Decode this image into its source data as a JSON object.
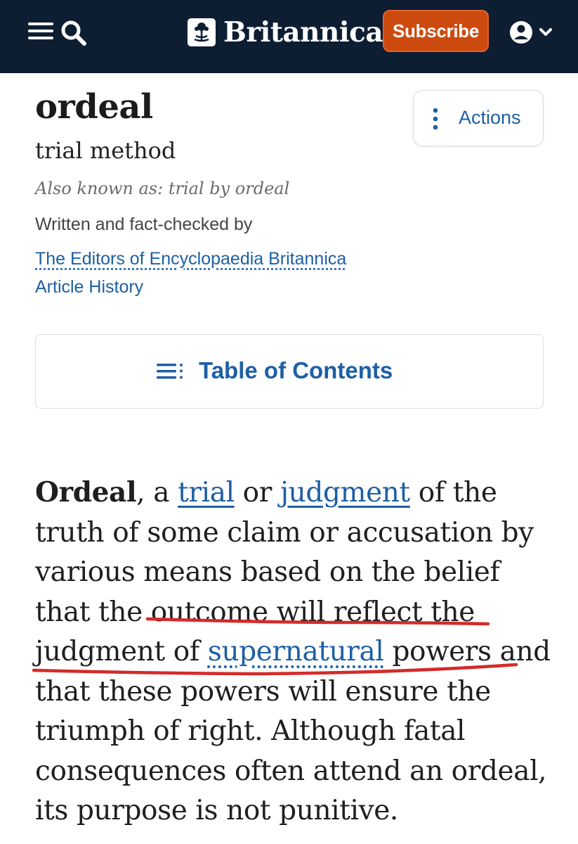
{
  "header": {
    "logo_text": "Britannica",
    "subscribe_label": "Subscribe",
    "background_color": "#0d1e33",
    "subscribe_color": "#cd4a0e",
    "icons": [
      "menu-icon",
      "search-icon",
      "thistle-logo-icon",
      "user-icon",
      "chevron-down-icon"
    ]
  },
  "article_header": {
    "title": "ordeal",
    "subtitle": "trial method",
    "also_known_as": "Also known as: trial by ordeal",
    "byline": "Written and fact-checked by",
    "author": "The Editors of Encyclopaedia Britannica",
    "history_link": "Article History"
  },
  "actions": {
    "label": "Actions",
    "icon": "vertical-dots-icon"
  },
  "toc": {
    "label": "Table of Contents",
    "icon": "list-icon"
  },
  "body": {
    "term": "Ordeal",
    "t1": ", a ",
    "link_trial": "trial",
    "t2": " or ",
    "link_judgment": "judgment",
    "t3": " of the truth of some claim or accusation by various means based on the belief that the outcome will reflect the judgment of ",
    "link_supernatural": "supernatural",
    "t4": " powers and that these powers will ensure the triumph of right. Although fatal consequences often attend an ordeal, its purpose is not punitive."
  },
  "annotation": {
    "color": "#d42a2a",
    "description_marks": "red-underline"
  },
  "link_color": "#1d5fa5"
}
